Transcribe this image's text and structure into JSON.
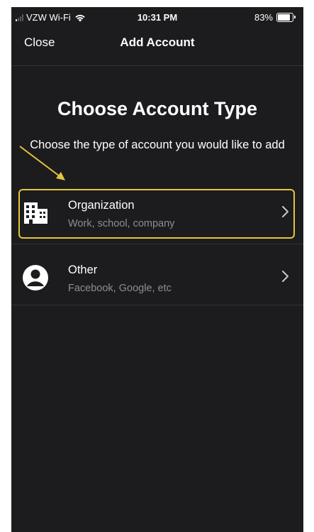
{
  "status_bar": {
    "carrier": "VZW Wi-Fi",
    "time": "10:31 PM",
    "battery_percent": "83%",
    "battery_level": 0.83
  },
  "nav": {
    "close_label": "Close",
    "title": "Add Account"
  },
  "main": {
    "heading": "Choose Account Type",
    "subheading": "Choose the type of account you would like to add"
  },
  "accounts": [
    {
      "title": "Organization",
      "subtitle": "Work, school, company",
      "icon": "building-icon"
    },
    {
      "title": "Other",
      "subtitle": "Facebook, Google, etc",
      "icon": "person-icon"
    }
  ],
  "colors": {
    "background": "#1c1c1e",
    "annotation": "#e5c53a",
    "secondary_text": "#8e8e93"
  }
}
